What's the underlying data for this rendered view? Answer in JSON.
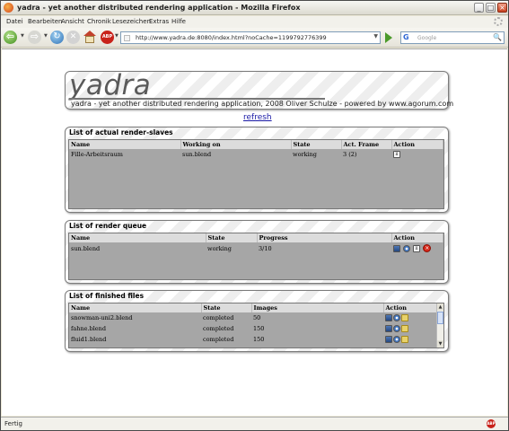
{
  "window": {
    "title": "yadra - yet another distributed rendering application - Mozilla Firefox",
    "min_glyph": "_",
    "max_glyph": "□",
    "close_glyph": "×"
  },
  "menu": [
    "Datei",
    "Bearbeiten",
    "Ansicht",
    "Chronik",
    "Lesezeichen",
    "Extras",
    "Hilfe"
  ],
  "nav": {
    "back_glyph": "⇦",
    "forward_glyph": "⇨",
    "reload_glyph": "↻",
    "stop_glyph": "✕",
    "abp_label": "ABP",
    "url": "http://www.yadra.de:8080/index.html?noCache=1199792776399",
    "search_engine_glyph": "G",
    "search_placeholder": "Google",
    "search_glyph": "🔍"
  },
  "header": {
    "logo": "yadra",
    "tagline": "yadra - yet another distributed rendering application, 2008 Oliver Schulze - powered by www.agorum.com"
  },
  "refresh_label": "refresh",
  "slaves": {
    "title": "List of actual render-slaves",
    "columns": [
      "Name",
      "Working on",
      "State",
      "Act. Frame",
      "Action"
    ],
    "rows": [
      {
        "name": "Fille-Arbeitsraum",
        "working_on": "sun.blend",
        "state": "working",
        "frame": "3 (2)"
      }
    ]
  },
  "queue": {
    "title": "List of render queue",
    "columns": [
      "Name",
      "State",
      "Progress",
      "Action"
    ],
    "rows": [
      {
        "name": "sun.blend",
        "state": "working",
        "progress": "3/10"
      }
    ]
  },
  "finished": {
    "title": "List of finished files",
    "columns": [
      "Name",
      "State",
      "Images",
      "Action"
    ],
    "rows": [
      {
        "name": "snowman-uni2.blend",
        "state": "completed",
        "images": "50"
      },
      {
        "name": "fahne.blend",
        "state": "completed",
        "images": "150"
      },
      {
        "name": "fluid1.blend",
        "state": "completed",
        "images": "150"
      }
    ]
  },
  "status": {
    "text": "Fertig",
    "abp_label": "ABP"
  }
}
